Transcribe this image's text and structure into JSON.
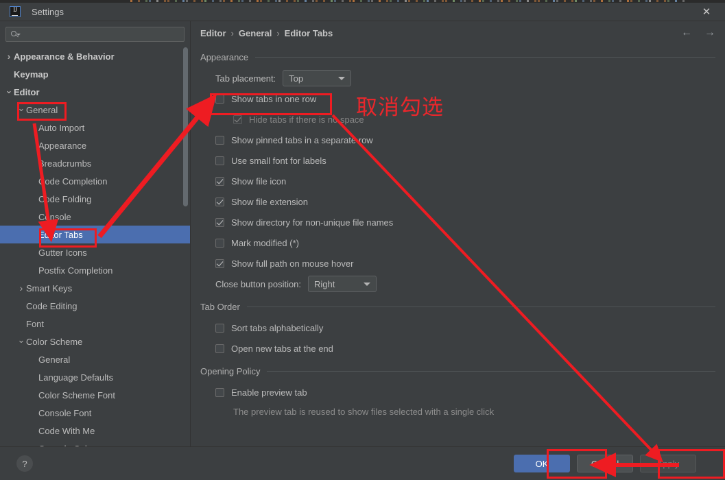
{
  "window": {
    "title": "Settings",
    "logo_icon": "intellij-idea-logo-icon",
    "close_icon": "close-icon"
  },
  "search": {
    "value": "",
    "placeholder": "",
    "icon": "search-icon"
  },
  "sidebar": {
    "items": [
      {
        "label": "Appearance & Behavior",
        "twisty": "right",
        "depth": 0,
        "bold": true,
        "selected": false
      },
      {
        "label": "Keymap",
        "twisty": "blank",
        "depth": 0,
        "bold": true,
        "selected": false
      },
      {
        "label": "Editor",
        "twisty": "down",
        "depth": 0,
        "bold": true,
        "selected": false
      },
      {
        "label": "General",
        "twisty": "down",
        "depth": 1,
        "bold": false,
        "selected": false
      },
      {
        "label": "Auto Import",
        "twisty": "blank",
        "depth": 2,
        "bold": false,
        "selected": false
      },
      {
        "label": "Appearance",
        "twisty": "blank",
        "depth": 2,
        "bold": false,
        "selected": false
      },
      {
        "label": "Breadcrumbs",
        "twisty": "blank",
        "depth": 2,
        "bold": false,
        "selected": false
      },
      {
        "label": "Code Completion",
        "twisty": "blank",
        "depth": 2,
        "bold": false,
        "selected": false
      },
      {
        "label": "Code Folding",
        "twisty": "blank",
        "depth": 2,
        "bold": false,
        "selected": false
      },
      {
        "label": "Console",
        "twisty": "blank",
        "depth": 2,
        "bold": false,
        "selected": false
      },
      {
        "label": "Editor Tabs",
        "twisty": "blank",
        "depth": 2,
        "bold": false,
        "selected": true
      },
      {
        "label": "Gutter Icons",
        "twisty": "blank",
        "depth": 2,
        "bold": false,
        "selected": false
      },
      {
        "label": "Postfix Completion",
        "twisty": "blank",
        "depth": 2,
        "bold": false,
        "selected": false
      },
      {
        "label": "Smart Keys",
        "twisty": "right",
        "depth": 1,
        "bold": false,
        "selected": false
      },
      {
        "label": "Code Editing",
        "twisty": "blank",
        "depth": 1,
        "bold": false,
        "selected": false
      },
      {
        "label": "Font",
        "twisty": "blank",
        "depth": 1,
        "bold": false,
        "selected": false
      },
      {
        "label": "Color Scheme",
        "twisty": "down",
        "depth": 1,
        "bold": false,
        "selected": false
      },
      {
        "label": "General",
        "twisty": "blank",
        "depth": 2,
        "bold": false,
        "selected": false
      },
      {
        "label": "Language Defaults",
        "twisty": "blank",
        "depth": 2,
        "bold": false,
        "selected": false
      },
      {
        "label": "Color Scheme Font",
        "twisty": "blank",
        "depth": 2,
        "bold": false,
        "selected": false
      },
      {
        "label": "Console Font",
        "twisty": "blank",
        "depth": 2,
        "bold": false,
        "selected": false
      },
      {
        "label": "Code With Me",
        "twisty": "blank",
        "depth": 2,
        "bold": false,
        "selected": false
      },
      {
        "label": "Console Colors",
        "twisty": "blank",
        "depth": 2,
        "bold": false,
        "selected": false
      }
    ]
  },
  "breadcrumb": {
    "items": [
      "Editor",
      "General",
      "Editor Tabs"
    ],
    "separator": "›",
    "back_icon": "arrow-left-icon",
    "forward_icon": "arrow-right-icon",
    "back_glyph": "←",
    "forward_glyph": "→"
  },
  "groups": [
    {
      "title": "Appearance",
      "rows": [
        {
          "kind": "combo",
          "label": "Tab placement:",
          "value": "Top",
          "name": "tab-placement"
        },
        {
          "kind": "checkbox",
          "label": "Show tabs in one row",
          "checked": false,
          "disabled": false,
          "indent": false,
          "name": "show-tabs-in-one-row"
        },
        {
          "kind": "checkbox",
          "label": "Hide tabs if there is no space",
          "checked": true,
          "disabled": true,
          "indent": true,
          "name": "hide-tabs-if-no-space"
        },
        {
          "kind": "checkbox",
          "label": "Show pinned tabs in a separate row",
          "checked": false,
          "disabled": false,
          "indent": false,
          "name": "show-pinned-tabs-separate-row"
        },
        {
          "kind": "checkbox",
          "label": "Use small font for labels",
          "checked": false,
          "disabled": false,
          "indent": false,
          "name": "use-small-font-for-labels"
        },
        {
          "kind": "checkbox",
          "label": "Show file icon",
          "checked": true,
          "disabled": false,
          "indent": false,
          "name": "show-file-icon"
        },
        {
          "kind": "checkbox",
          "label": "Show file extension",
          "checked": true,
          "disabled": false,
          "indent": false,
          "name": "show-file-extension"
        },
        {
          "kind": "checkbox",
          "label": "Show directory for non-unique file names",
          "checked": true,
          "disabled": false,
          "indent": false,
          "name": "show-directory-non-unique"
        },
        {
          "kind": "checkbox",
          "label": "Mark modified (*)",
          "checked": false,
          "disabled": false,
          "indent": false,
          "name": "mark-modified"
        },
        {
          "kind": "checkbox",
          "label": "Show full path on mouse hover",
          "checked": true,
          "disabled": false,
          "indent": false,
          "name": "show-full-path-on-hover"
        },
        {
          "kind": "combo",
          "label": "Close button position:",
          "value": "Right",
          "name": "close-button-position"
        }
      ]
    },
    {
      "title": "Tab Order",
      "rows": [
        {
          "kind": "checkbox",
          "label": "Sort tabs alphabetically",
          "checked": false,
          "disabled": false,
          "indent": false,
          "name": "sort-tabs-alphabetically"
        },
        {
          "kind": "checkbox",
          "label": "Open new tabs at the end",
          "checked": false,
          "disabled": false,
          "indent": false,
          "name": "open-new-tabs-at-end"
        }
      ]
    },
    {
      "title": "Opening Policy",
      "rows": [
        {
          "kind": "checkbox",
          "label": "Enable preview tab",
          "checked": false,
          "disabled": false,
          "indent": false,
          "name": "enable-preview-tab"
        },
        {
          "kind": "hint",
          "label": "The preview tab is reused to show files selected with a single click",
          "name": "preview-tab-hint"
        }
      ]
    }
  ],
  "footer": {
    "help_label": "?",
    "ok_label": "OK",
    "cancel_label": "Cancel",
    "apply_label": "Apply",
    "apply_disabled": true
  },
  "annotations": {
    "note_text": "取消勾选",
    "color": "#ee1c22"
  }
}
